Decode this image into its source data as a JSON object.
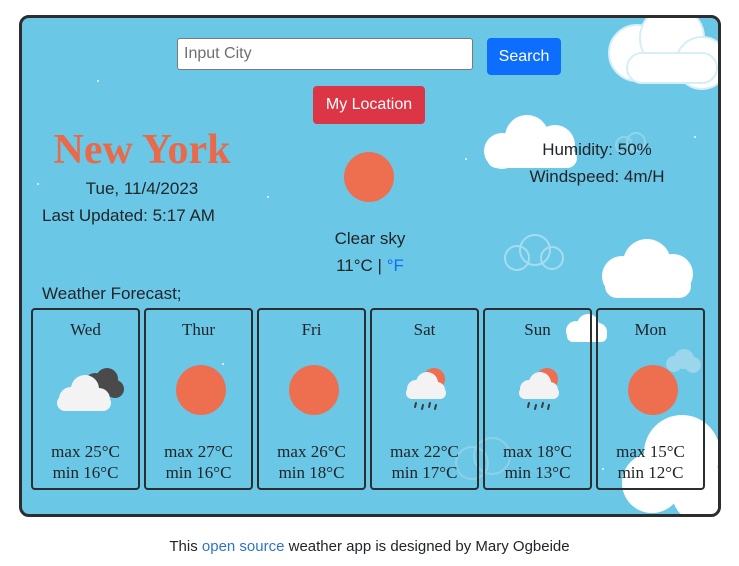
{
  "search": {
    "placeholder": "Input City",
    "button_label": "Search"
  },
  "location_button_label": "My Location",
  "current": {
    "city": "New York",
    "date": "Tue, 11/4/2023",
    "updated_label": "Last Updated: 5:17 AM",
    "description": "Clear sky",
    "temp_c": "11°C",
    "separator": " | ",
    "unit_f": "°F",
    "humidity": "Humidity: 50%",
    "windspeed": "Windspeed: 4m/H",
    "icon": "sun-icon"
  },
  "forecast_title": "Weather Forecast;",
  "forecast": [
    {
      "day": "Wed",
      "icon": "cloudy-icon",
      "max": "max 25°C",
      "min": "min 16°C"
    },
    {
      "day": "Thur",
      "icon": "sun-icon",
      "max": "max 27°C",
      "min": "min 16°C"
    },
    {
      "day": "Fri",
      "icon": "sun-icon",
      "max": "max 26°C",
      "min": "min 18°C"
    },
    {
      "day": "Sat",
      "icon": "rain-icon",
      "max": "max 22°C",
      "min": "min 17°C"
    },
    {
      "day": "Sun",
      "icon": "rain-icon",
      "max": "max 18°C",
      "min": "min 13°C"
    },
    {
      "day": "Mon",
      "icon": "sun-icon",
      "max": "max 15°C",
      "min": "min 12°C"
    }
  ],
  "footer": {
    "prefix": "This ",
    "link_text": "open source",
    "suffix": " weather app is designed by Mary Ogbeide"
  },
  "colors": {
    "card_background": "#6ac7e6",
    "search_button": "#0d6efd",
    "location_button": "#dc3545",
    "city_text": "#e86a4a",
    "sun": "#ee6e50"
  }
}
